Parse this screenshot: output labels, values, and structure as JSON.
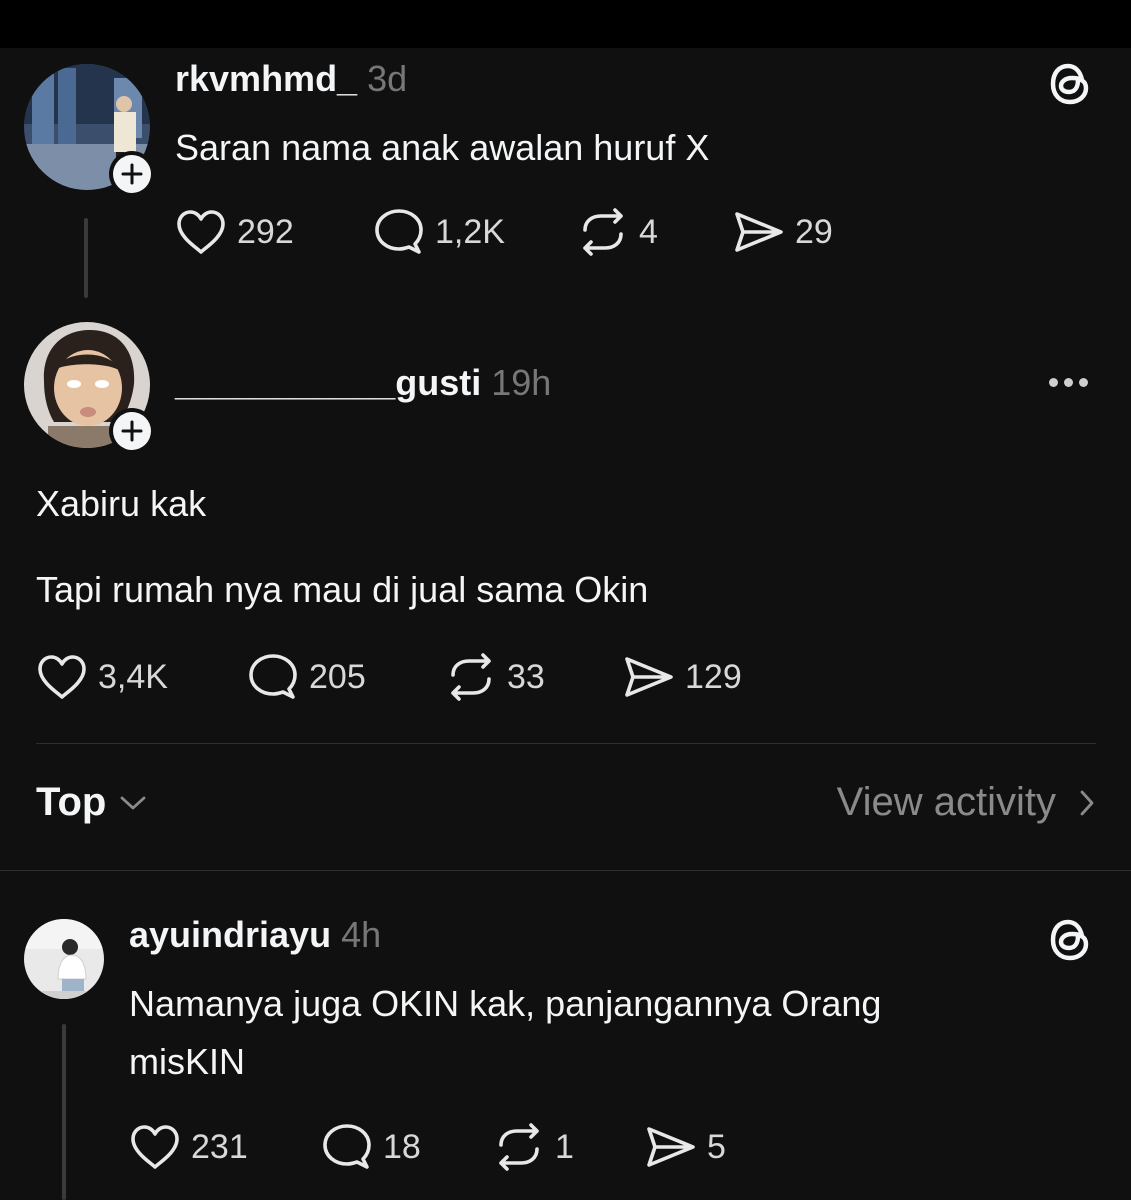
{
  "posts": [
    {
      "username": "rkvmhmd_",
      "time": "3d",
      "text_lines": [
        "Saran nama anak awalan huruf X"
      ],
      "likes": "292",
      "replies": "1,2K",
      "reposts": "4",
      "shares": "29"
    },
    {
      "username": "___________gusti",
      "time": "19h",
      "text_lines": [
        "Xabiru kak",
        "Tapi rumah nya mau di jual sama Okin"
      ],
      "likes": "3,4K",
      "replies": "205",
      "reposts": "33",
      "shares": "129"
    },
    {
      "username": "ayuindriayu",
      "time": "4h",
      "text_lines": [
        "Namanya juga OKIN kak, panjangannya Orang",
        "misKIN"
      ],
      "likes": "231",
      "replies": "18",
      "reposts": "1",
      "shares": "5"
    }
  ],
  "sort": {
    "label": "Top",
    "icon": "chevron-down-icon"
  },
  "activity": {
    "label": "View activity",
    "icon": "chevron-right-icon"
  },
  "colors": {
    "background": "#101010",
    "text": "#f3f5f7",
    "muted": "#777777"
  }
}
